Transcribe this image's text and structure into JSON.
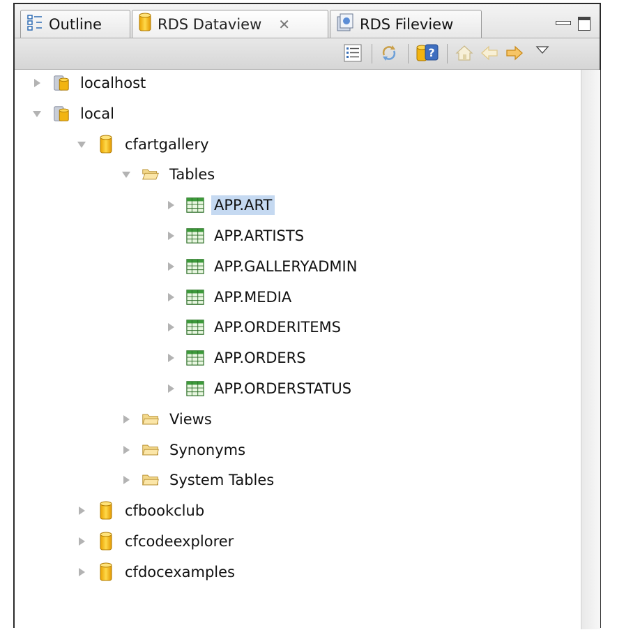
{
  "tabs": [
    {
      "label": "Outline"
    },
    {
      "label": "RDS Dataview",
      "close": "✕"
    },
    {
      "label": "RDS Fileview"
    }
  ],
  "toolbar": {
    "icons": [
      "list-icon",
      "refresh-icon",
      "database-help-icon",
      "home-icon",
      "back-arrow-icon",
      "forward-arrow-icon",
      "view-menu-icon"
    ]
  },
  "tree": [
    {
      "label": "localhost",
      "level": 0,
      "expanded": false,
      "icon": "server-icon"
    },
    {
      "label": "local",
      "level": 0,
      "expanded": true,
      "icon": "server-icon"
    },
    {
      "label": "cfartgallery",
      "level": 1,
      "expanded": true,
      "icon": "datasource-icon"
    },
    {
      "label": "Tables",
      "level": 2,
      "expanded": true,
      "icon": "folder-open-icon"
    },
    {
      "label": "APP.ART",
      "level": 3,
      "expanded": false,
      "icon": "table-icon",
      "selected": true
    },
    {
      "label": "APP.ARTISTS",
      "level": 3,
      "expanded": false,
      "icon": "table-icon"
    },
    {
      "label": "APP.GALLERYADMIN",
      "level": 3,
      "expanded": false,
      "icon": "table-icon"
    },
    {
      "label": "APP.MEDIA",
      "level": 3,
      "expanded": false,
      "icon": "table-icon"
    },
    {
      "label": "APP.ORDERITEMS",
      "level": 3,
      "expanded": false,
      "icon": "table-icon"
    },
    {
      "label": "APP.ORDERS",
      "level": 3,
      "expanded": false,
      "icon": "table-icon"
    },
    {
      "label": "APP.ORDERSTATUS",
      "level": 3,
      "expanded": false,
      "icon": "table-icon"
    },
    {
      "label": "Views",
      "level": 2,
      "expanded": false,
      "icon": "folder-icon"
    },
    {
      "label": "Synonyms",
      "level": 2,
      "expanded": false,
      "icon": "folder-icon"
    },
    {
      "label": "System Tables",
      "level": 2,
      "expanded": false,
      "icon": "folder-icon"
    },
    {
      "label": "cfbookclub",
      "level": 1,
      "expanded": false,
      "icon": "datasource-icon"
    },
    {
      "label": "cfcodeexplorer",
      "level": 1,
      "expanded": false,
      "icon": "datasource-icon"
    },
    {
      "label": "cfdocexamples",
      "level": 1,
      "expanded": false,
      "icon": "datasource-icon"
    }
  ],
  "colors": {
    "selection": "#c5d9f1",
    "table_green": "#2f9a3a",
    "db_yellow": "#f2b410"
  }
}
